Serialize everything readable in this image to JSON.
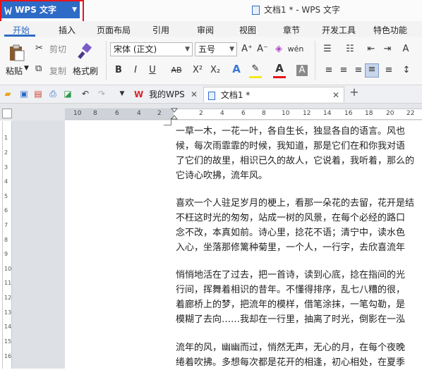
{
  "titlebar": {
    "app_menu_label": "WPS 文字",
    "window_title": "文档1 * - WPS 文字"
  },
  "ribbon_tabs": [
    "开始",
    "插入",
    "页面布局",
    "引用",
    "审阅",
    "视图",
    "章节",
    "开发工具",
    "特色功能"
  ],
  "ribbon": {
    "cut": "剪切",
    "copy": "复制",
    "paste": "粘贴",
    "format_painter": "格式刷",
    "font_name": "宋体 (正文)",
    "font_size": "五号",
    "bold": "B",
    "italic": "I",
    "underline": "U",
    "strikethrough": "AB",
    "superscript": "X²",
    "subscript": "X₂",
    "grow_font": "A⁺",
    "shrink_font": "A⁻",
    "font_color": "A",
    "char_shading": "A"
  },
  "document_tabs": {
    "my_wps": "我的WPS",
    "doc1": "文档1 *"
  },
  "ruler_h_numbers": [
    "10",
    "8",
    "6",
    "4",
    "2",
    "",
    "2",
    "4",
    "6",
    "8",
    "10",
    "12",
    "14",
    "16",
    "18",
    "20",
    "22"
  ],
  "ruler_v_numbers": [
    "1",
    "2",
    "3",
    "4",
    "5",
    "6",
    "7",
    "8",
    "9",
    "10",
    "11",
    "12",
    "13",
    "14",
    "15",
    "16"
  ],
  "document": {
    "paragraphs": [
      [
        "一草一木，一花一叶，各自生长，独显各自的语言。风也",
        "候，每次雨霏霏的时候，我知道，那是它们在和你我对语",
        "了它们的故里，相识已久的故人，它说着，我听着，那么的",
        "它诗心吹拂，流年风。"
      ],
      [
        "喜欢一个人驻足岁月的梗上，看那一朵花的去留，花开是结",
        "不枉这时光的匆匆，站成一树的风景，在每个必经的路口",
        "念不改，本真如前。诗心里，捻花不语；清宁中，读水色",
        "入心，坐落那修篱种菊里，一个人，一行字，去欣喜流年"
      ],
      [
        "悄悄地活在了过去，把一首诗，读到心底，捻在指间的光",
        "行间，挥舞着相识的昔年。不懂得排序，乱七八糟的很，",
        "着廊桥上的梦，把流年的模样，借笔涂抹，一笔勾勒，是",
        "模糊了去向……我却在一行里，抽离了时光，倒影在一泓"
      ],
      [
        "流年的风，幽幽而过，悄然无声，无心的月，在每个夜晚",
        "绻着吹拂。多想每次都是花开的相逢，初心相处，在夏季"
      ]
    ]
  }
}
